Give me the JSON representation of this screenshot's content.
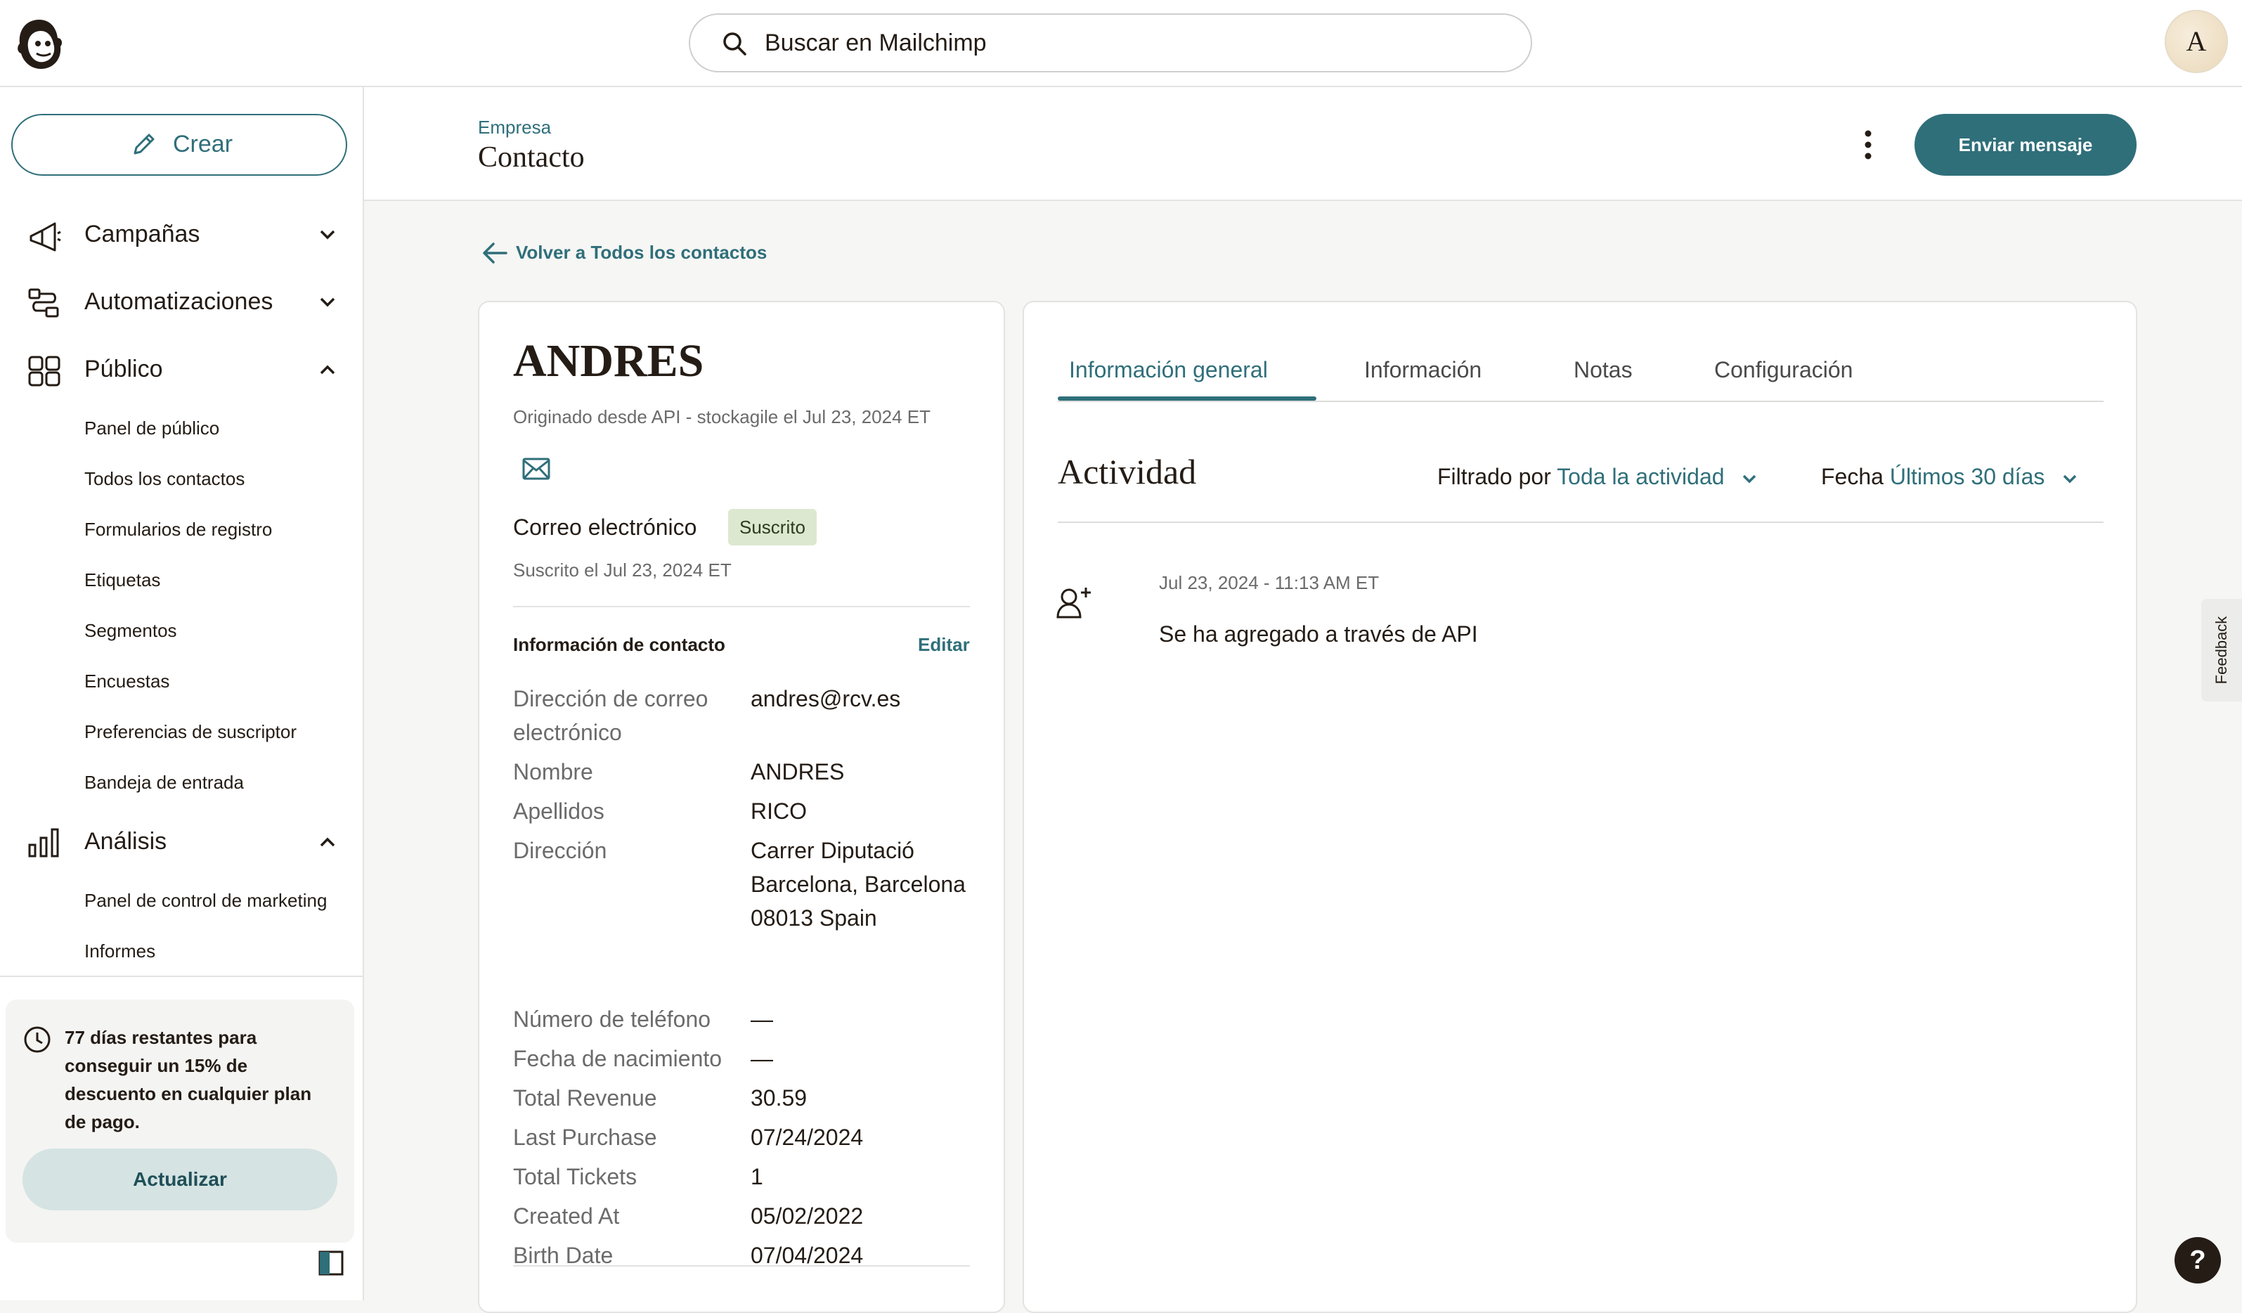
{
  "topbar": {
    "search_placeholder": "Buscar en Mailchimp",
    "avatar_initial": "A"
  },
  "sidebar": {
    "create_label": "Crear",
    "nav": [
      {
        "label": "Campañas",
        "icon": "megaphone-icon",
        "expanded": false
      },
      {
        "label": "Automatizaciones",
        "icon": "automation-icon",
        "expanded": false
      },
      {
        "label": "Público",
        "icon": "audience-icon",
        "expanded": true
      },
      {
        "label": "Análisis",
        "icon": "bar-chart-icon",
        "expanded": true
      }
    ],
    "audience_items": [
      "Panel de público",
      "Todos los contactos",
      "Formularios de registro",
      "Etiquetas",
      "Segmentos",
      "Encuestas",
      "Preferencias de suscriptor",
      "Bandeja de entrada"
    ],
    "analytics_items": [
      "Panel de control de marketing",
      "Informes"
    ],
    "promo_text": "77 días restantes para conseguir un 15% de descuento en cualquier plan de pago.",
    "upgrade_label": "Actualizar"
  },
  "header": {
    "breadcrumb": "Empresa",
    "title": "Contacto",
    "send_label": "Enviar mensaje"
  },
  "back_label": "Volver a Todos los contactos",
  "contact": {
    "name": "ANDRES",
    "origin": "Originado desde API - stockagile el Jul 23, 2024 ET",
    "email_channel": "Correo electrónico",
    "status": "Suscrito",
    "subscribed_date": "Suscrito el Jul 23, 2024 ET",
    "info_title": "Información de contacto",
    "edit_label": "Editar",
    "fields": [
      {
        "label": "Dirección de correo electrónico",
        "value": "andres@rcv.es"
      },
      {
        "label": "Nombre",
        "value": "ANDRES"
      },
      {
        "label": "Apellidos",
        "value": "RICO"
      },
      {
        "label": "Dirección",
        "value": "Carrer Diputació Barcelona, Barcelona 08013 Spain"
      },
      {
        "label": "Número de teléfono",
        "value": "—"
      },
      {
        "label": "Fecha de nacimiento",
        "value": "—"
      },
      {
        "label": "Total Revenue",
        "value": "30.59"
      },
      {
        "label": "Last Purchase",
        "value": "07/24/2024"
      },
      {
        "label": "Total Tickets",
        "value": "1"
      },
      {
        "label": "Created At",
        "value": "05/02/2022"
      },
      {
        "label": "Birth Date",
        "value": "07/04/2024"
      }
    ]
  },
  "activity": {
    "tabs": [
      "Información general",
      "Información",
      "Notas",
      "Configuración"
    ],
    "active_tab": 0,
    "title": "Actividad",
    "filter_label": "Filtrado por",
    "filter_value": "Toda la actividad",
    "date_label": "Fecha",
    "date_value": "Últimos 30 días",
    "events": [
      {
        "time": "Jul 23, 2024 - 11:13 AM ET",
        "text": "Se ha agregado a través de API"
      }
    ]
  },
  "feedback_label": "Feedback",
  "help_label": "?",
  "colors": {
    "brand": "#2f6f7a",
    "ink": "#241c15",
    "badge_bg": "#dde8d0"
  }
}
